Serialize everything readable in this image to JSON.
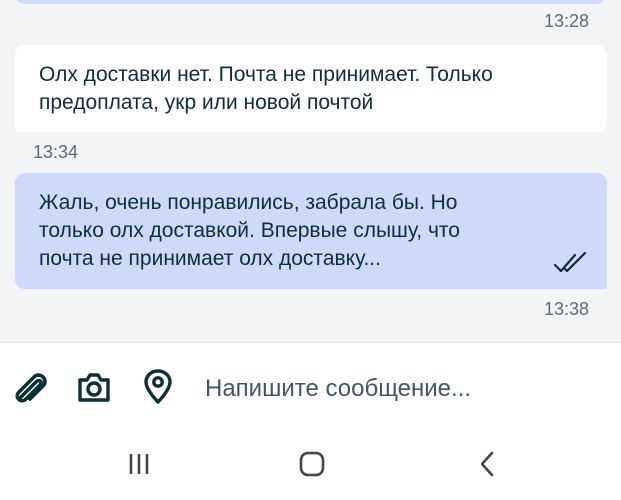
{
  "chat": {
    "messages": [
      {
        "direction": "outgoing",
        "time": "13:28",
        "text": ""
      },
      {
        "direction": "incoming",
        "time": "13:34",
        "text": "Олх доставки нет. Почта не принимает. Только\nпредоплата, укр или новой почтой"
      },
      {
        "direction": "outgoing",
        "time": "13:38",
        "text": "Жаль, очень понравились, забрала бы. Но\nтолько олх доставкой. Впервые слышу, что\nпочта не принимает олх доставку...",
        "status_icon": "double-check-icon"
      }
    ]
  },
  "input_bar": {
    "placeholder": "Напишите сообщение...",
    "value": "",
    "icons": [
      "paperclip-icon",
      "camera-icon",
      "location-pin-icon"
    ]
  },
  "nav_bar": {
    "icons": [
      "recent-apps-icon",
      "home-icon",
      "back-icon"
    ]
  },
  "colors": {
    "background": "#f2f4f5",
    "incoming_bubble": "#ffffff",
    "outgoing_bubble": "#ced9fb",
    "text": "#0d2f36",
    "icon": "#0d2f36",
    "timestamp": "#5d6d72"
  }
}
